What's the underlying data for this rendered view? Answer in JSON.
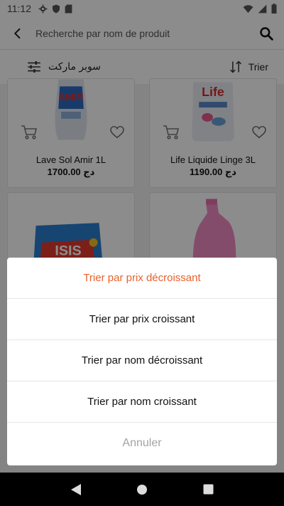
{
  "status_bar": {
    "time": "11:12"
  },
  "app_bar": {
    "search_placeholder": "Recherche par nom de produit"
  },
  "filter_bar": {
    "category": "سوبر ماركت",
    "sort_label": "Trier"
  },
  "products": [
    {
      "name": "Lave Sol Amir 1L",
      "price": "1700.00 دج",
      "brand_text": "AMIR"
    },
    {
      "name": "Life Liquide Linge 3L",
      "price": "1190.00 دج",
      "brand_text": "Life"
    },
    {
      "name": "",
      "price": "",
      "brand_text": "ISIS"
    },
    {
      "name": "",
      "price": "",
      "brand_text": ""
    }
  ],
  "sort_sheet": {
    "options": [
      "Trier par prix décroissant",
      "Trier par prix croissant",
      "Trier par nom décroissant",
      "Trier par nom croissant"
    ],
    "selected_index": 0,
    "cancel_label": "Annuler"
  },
  "colors": {
    "accent": "#e8612c",
    "cancel_text": "#a3a3a3"
  }
}
